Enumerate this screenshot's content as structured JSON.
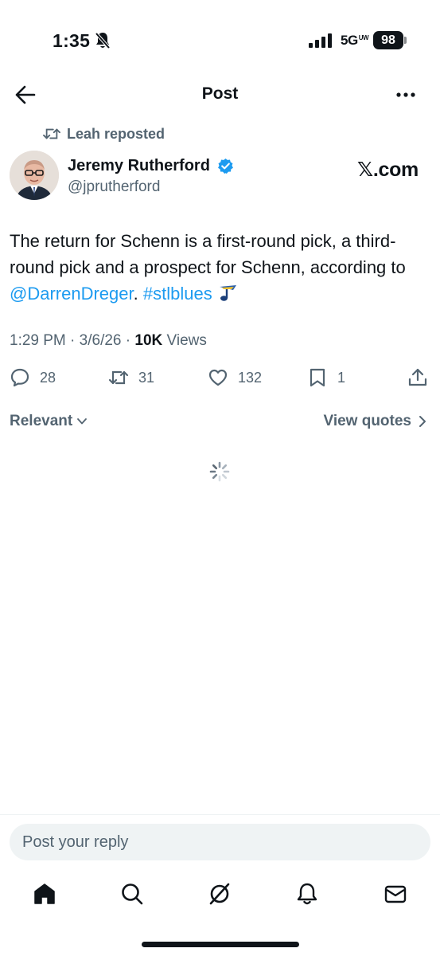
{
  "status_bar": {
    "time": "1:35",
    "network": "5G",
    "network_badge": "UW",
    "battery": "98",
    "icons": [
      "bell-slash-icon",
      "signal-icon"
    ]
  },
  "header": {
    "title": "Post",
    "icons": [
      "back-arrow-icon",
      "more-icon"
    ]
  },
  "repost": {
    "label": "Leah reposted",
    "icon": "repost-icon"
  },
  "author": {
    "name": "Jeremy Rutherford",
    "handle": "@jprutherford",
    "verified": true,
    "source_mark": "𝕏.com"
  },
  "post": {
    "text_before": "The return for Schenn is a first-round pick, a third-round pick and a prospect for Schenn, according to ",
    "mention": "@DarrenDreger",
    "text_mid": ". ",
    "hashtag": "#stlblues",
    "emoji_icon": "blues-note-icon",
    "time": "1:29 PM",
    "date": "3/6/26",
    "views_count": "10K",
    "views_label": "Views",
    "separator": " · "
  },
  "actions": {
    "replies": "28",
    "reposts": "31",
    "likes": "132",
    "bookmarks": "1",
    "icons": [
      "reply-icon",
      "repost-icon",
      "like-icon",
      "bookmark-icon",
      "share-icon"
    ]
  },
  "filters": {
    "sort_label": "Relevant",
    "view_quotes": "View quotes"
  },
  "reply": {
    "placeholder": "Post your reply"
  },
  "tab_bar": {
    "tabs": [
      "home-icon",
      "search-icon",
      "grok-icon",
      "notifications-icon",
      "messages-icon"
    ]
  },
  "colors": {
    "text": "#0f1419",
    "secondary": "#536471",
    "link": "#1d9bf0",
    "input_bg": "#eff3f4"
  }
}
